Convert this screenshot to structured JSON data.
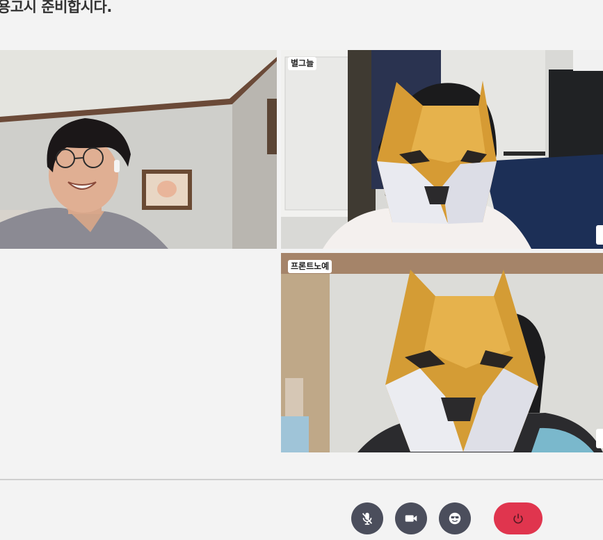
{
  "room": {
    "title": "용고시 준비합시다."
  },
  "participants": [
    {
      "name": "",
      "video": "person-with-glasses",
      "name_visible": false
    },
    {
      "name": "별그늘",
      "video": "shiba-mask"
    },
    {
      "name": "프론트노예",
      "video": "shiba-mask"
    }
  ],
  "controls": [
    {
      "id": "mic",
      "icon": "mic-off-icon",
      "state": "muted"
    },
    {
      "id": "camera",
      "icon": "video-camera-icon",
      "state": "on"
    },
    {
      "id": "face-filter",
      "icon": "sunglasses-face-icon",
      "state": "on"
    },
    {
      "id": "leave",
      "icon": "power-icon",
      "state": "idle"
    }
  ],
  "colors": {
    "control_bg": "#4b4e5c",
    "leave_bg": "#e0354e",
    "page_bg": "#f3f3f3"
  }
}
